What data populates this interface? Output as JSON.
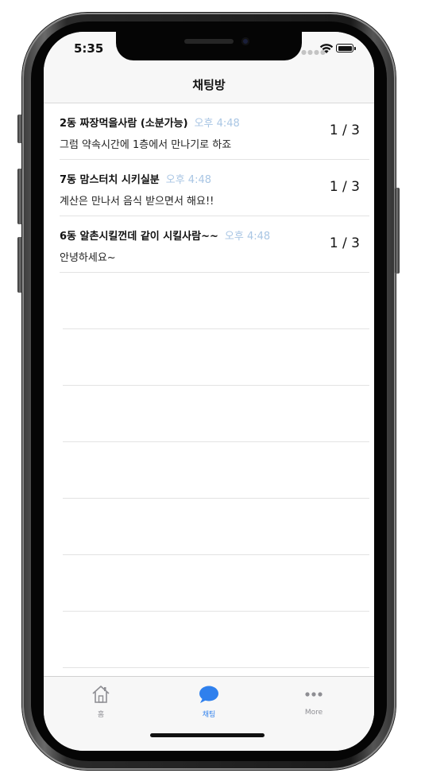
{
  "status_bar": {
    "time": "5:35"
  },
  "nav": {
    "title": "채팅방"
  },
  "chats": [
    {
      "title": "2동 짜장먹을사람 (소분가능)",
      "time": "오후 4:48",
      "message": "그럼 약속시간에 1층에서 만나기로 하죠",
      "count": "1 / 3"
    },
    {
      "title": "7동 맘스터치 시키실분",
      "time": "오후 4:48",
      "message": "계산은 만나서 음식 받으면서 해요!!",
      "count": "1 / 3"
    },
    {
      "title": "6동 알촌시킬껀데 같이 시킬사람~~",
      "time": "오후 4:48",
      "message": "안녕하세요~",
      "count": "1 / 3"
    }
  ],
  "tabs": [
    {
      "label": "홈",
      "icon": "home-icon",
      "active": false
    },
    {
      "label": "채팅",
      "icon": "chat-bubble-icon",
      "active": true
    },
    {
      "label": "More",
      "icon": "more-dots-icon",
      "active": false
    }
  ],
  "colors": {
    "accent": "#2f80ed",
    "inactive_tab": "#8e8e93",
    "timestamp": "#a9c6e4",
    "bar_background": "#f7f7f7"
  }
}
